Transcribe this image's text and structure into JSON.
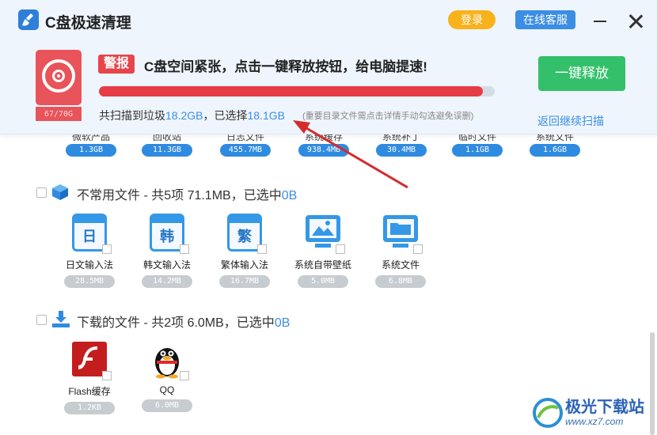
{
  "app": {
    "title": "C盘极速清理",
    "login_label": "登录",
    "service_label": "在线客服"
  },
  "alert": {
    "disk_usage": "67/70G",
    "badge": "警报",
    "message": "C盘空间紧张，点击一键释放按钮，给电脑提速!",
    "progress_fraction": 0.97,
    "scan_prefix": "共扫描到垃圾",
    "scanned_size": "18.2GB",
    "scan_mid": "，已选择",
    "selected_size": "18.1GB",
    "hint": "(重要目录文件需点击详情手动勾选避免误删)",
    "release_label": "一键释放",
    "back_label": "返回继续扫描"
  },
  "partial_items": [
    {
      "label": "微软产品",
      "size": "1.3GB"
    },
    {
      "label": "回收站",
      "size": "11.3GB"
    },
    {
      "label": "日志文件",
      "size": "455.7MB"
    },
    {
      "label": "系统缓存",
      "size": "938.4MB"
    },
    {
      "label": "系统补丁",
      "size": "30.4MB"
    },
    {
      "label": "临时文件",
      "size": "1.1GB"
    },
    {
      "label": "系统文件",
      "size": "1.6GB"
    }
  ],
  "sections": {
    "uncommon": {
      "title": "不常用文件 - 共5项 71.1MB，已选中",
      "selected": "0B"
    },
    "downloads": {
      "title": "下载的文件 - 共2项 6.0MB，已选中",
      "selected": "0B"
    }
  },
  "uncommon_items": [
    {
      "name": "日文输入法",
      "size": "28.5MB",
      "glyph": "日"
    },
    {
      "name": "韩文输入法",
      "size": "14.2MB",
      "glyph": "韩"
    },
    {
      "name": "繁体输入法",
      "size": "16.7MB",
      "glyph": "繁"
    },
    {
      "name": "系统自带壁纸",
      "size": "5.0MB",
      "icon": "monitor-wallpaper-icon"
    },
    {
      "name": "系统文件",
      "size": "6.8MB",
      "icon": "monitor-folder-icon"
    }
  ],
  "download_items": [
    {
      "name": "Flash缓存",
      "size": "1.2KB",
      "icon": "flash-icon"
    },
    {
      "name": "QQ",
      "size": "6.0MB",
      "icon": "qq-penguin-icon"
    }
  ],
  "watermark": {
    "name": "极光下载站",
    "url": "www.xz7.com"
  },
  "colors": {
    "accent": "#3b8ee3",
    "alert": "#e6454b",
    "release": "#34c06a",
    "login": "#f7b21c"
  }
}
